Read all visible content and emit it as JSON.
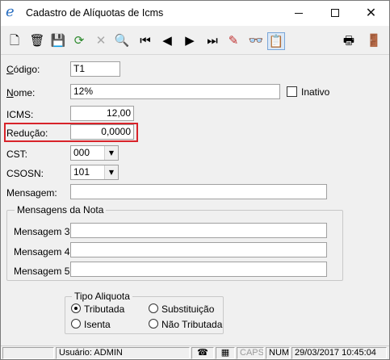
{
  "window": {
    "title": "Cadastro de Alíquotas de Icms",
    "app_icon": "e",
    "controls": {
      "minimize": "minimize-icon",
      "maximize": "maximize-icon",
      "close": "✕"
    }
  },
  "toolbar": {
    "buttons": [
      {
        "name": "new-document-icon",
        "glyph": "🗋"
      },
      {
        "name": "delete-trash-icon",
        "glyph": "🗑"
      },
      {
        "name": "save-disk-icon",
        "glyph": "💾"
      },
      {
        "name": "refresh-icon",
        "glyph": "⟳"
      },
      {
        "name": "cancel-x-icon",
        "glyph": "✕"
      },
      {
        "name": "search-icon",
        "glyph": "🔍"
      },
      {
        "name": "first-record-icon",
        "glyph": "⏮"
      },
      {
        "name": "previous-record-icon",
        "glyph": "◀"
      },
      {
        "name": "next-record-icon",
        "glyph": "▶"
      },
      {
        "name": "last-record-icon",
        "glyph": "⏭"
      },
      {
        "name": "eraser-icon",
        "glyph": "✎"
      },
      {
        "name": "binoculars-icon",
        "glyph": "👓"
      },
      {
        "name": "notes-icon",
        "glyph": "📋"
      },
      {
        "name": "print-icon",
        "glyph": "🖶"
      },
      {
        "name": "exit-door-icon",
        "glyph": "🚪"
      }
    ]
  },
  "form": {
    "codigo": {
      "label_u": "C",
      "label_rest": "ódigo:",
      "value": "T1"
    },
    "nome": {
      "label_u": "N",
      "label_rest": "ome:",
      "value": "12%"
    },
    "inativo": {
      "label": "Inativo",
      "checked": false
    },
    "icms": {
      "label": "ICMS:",
      "value": "12,00"
    },
    "reducao": {
      "label": "Redução:",
      "value": "0,0000"
    },
    "cst": {
      "label": "CST:",
      "value": "000"
    },
    "csosn": {
      "label": "CSOSN:",
      "value": "101"
    },
    "mensagem": {
      "label": "Mensagem:",
      "value": ""
    }
  },
  "mensagens_nota": {
    "title": "Mensagens da Nota",
    "m3": {
      "label": "Mensagem 3:",
      "value": ""
    },
    "m4": {
      "label": "Mensagem 4:",
      "value": ""
    },
    "m5": {
      "label": "Mensagem 5:",
      "value": ""
    }
  },
  "tipo_aliquota": {
    "title": "Tipo Aliquota",
    "options": [
      {
        "label": "Tributada",
        "checked": true
      },
      {
        "label": "Substituição",
        "checked": false
      },
      {
        "label": "Isenta",
        "checked": false
      },
      {
        "label": "Não Tributada",
        "checked": false
      }
    ]
  },
  "status": {
    "user": "Usuário: ADMIN",
    "phone_icon": "☎",
    "calc_icon": "▦",
    "caps": "CAPS",
    "num": "NUM",
    "datetime": "29/03/2017 10:45:04"
  },
  "colors": {
    "highlight": "#d8232a",
    "window_bg": "#f0f0f0",
    "accent": "#2a6fc1"
  }
}
